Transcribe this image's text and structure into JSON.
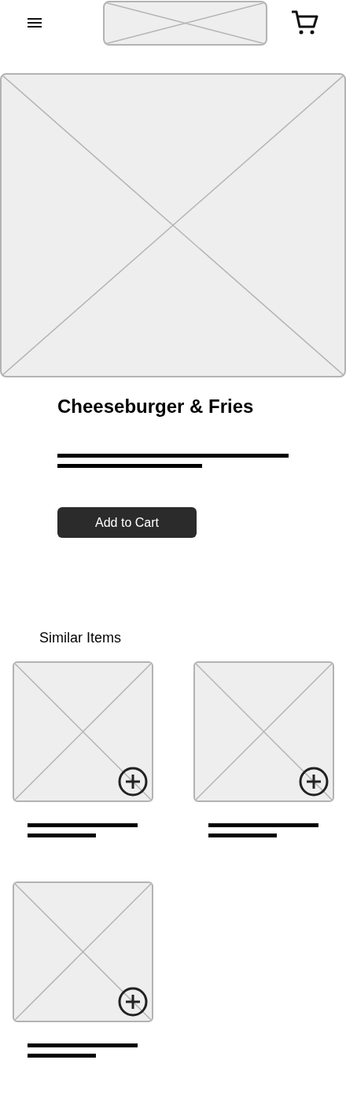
{
  "product": {
    "title": "Cheeseburger & Fries",
    "image": {
      "kind": "placeholder"
    },
    "description": {
      "kind": "placeholder-lines"
    },
    "button": "Add to Cart"
  },
  "similar_items": {
    "title": "Similar Items",
    "items": [
      {
        "kind": "placeholder"
      },
      {
        "kind": "placeholder"
      },
      {
        "kind": "placeholder"
      }
    ]
  }
}
